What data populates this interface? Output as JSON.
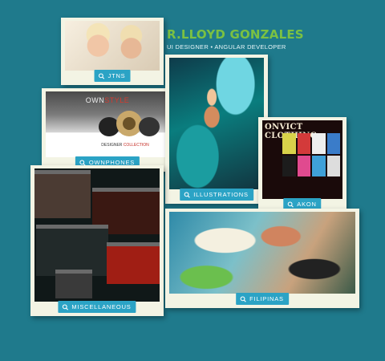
{
  "brand": {
    "name": "R.LLOYD GONZALES",
    "subtitle": "UI DESIGNER • ANGULAR DEVELOPER",
    "name_color": "#7bc142"
  },
  "colors": {
    "background": "#1f7a8c",
    "card": "#f3f4e4",
    "label": "#2ba3c5"
  },
  "portfolio": {
    "items": [
      {
        "id": "jtns",
        "label": "JTNS",
        "icon": "zoom-icon"
      },
      {
        "id": "ownphones",
        "label": "OWNPHONES",
        "icon": "zoom-icon",
        "thumb": {
          "title_a": "OWN",
          "title_b": "STYLE",
          "foot_a": "DESIGNER",
          "foot_b": "COLLECTION"
        }
      },
      {
        "id": "illustrations",
        "label": "ILLUSTRATIONS",
        "icon": "zoom-icon"
      },
      {
        "id": "akon",
        "label": "AKON",
        "icon": "zoom-icon",
        "thumb": {
          "title": "ONVICT CLOTHING"
        }
      },
      {
        "id": "miscellaneous",
        "label": "MISCELLANEOUS",
        "icon": "zoom-icon"
      },
      {
        "id": "filipinas",
        "label": "FILIPINAS",
        "icon": "zoom-icon"
      }
    ]
  }
}
